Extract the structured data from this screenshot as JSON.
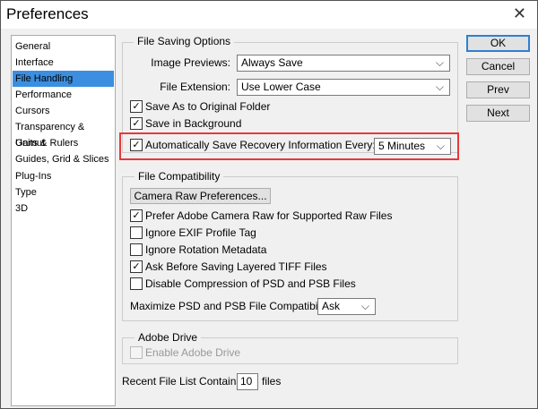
{
  "title": "Preferences",
  "sidebar": {
    "items": [
      "General",
      "Interface",
      "File Handling",
      "Performance",
      "Cursors",
      "Transparency & Gamut",
      "Units & Rulers",
      "Guides, Grid & Slices",
      "Plug-Ins",
      "Type",
      "3D"
    ],
    "selected": "File Handling"
  },
  "buttons": {
    "ok": "OK",
    "cancel": "Cancel",
    "prev": "Prev",
    "next": "Next"
  },
  "file_saving": {
    "legend": "File Saving Options",
    "image_previews_label": "Image Previews:",
    "image_previews_value": "Always Save",
    "file_extension_label": "File Extension:",
    "file_extension_value": "Use Lower Case",
    "save_original": "Save As to Original Folder",
    "save_background": "Save in Background",
    "auto_save": "Automatically Save Recovery Information Every:",
    "auto_save_value": "5 Minutes"
  },
  "compat": {
    "legend": "File Compatibility",
    "camera_raw_button": "Camera Raw Preferences...",
    "items": [
      {
        "label": "Prefer Adobe Camera Raw for Supported Raw Files",
        "checked": true
      },
      {
        "label": "Ignore EXIF Profile Tag",
        "checked": false
      },
      {
        "label": "Ignore Rotation Metadata",
        "checked": false
      },
      {
        "label": "Ask Before Saving Layered TIFF Files",
        "checked": true
      },
      {
        "label": "Disable Compression of PSD and PSB Files",
        "checked": false
      }
    ],
    "maximize_label": "Maximize PSD and PSB File Compatibility:",
    "maximize_value": "Ask"
  },
  "drive": {
    "legend": "Adobe Drive",
    "enable": "Enable Adobe Drive"
  },
  "recent": {
    "label": "Recent File List Contains:",
    "value": "10",
    "suffix": "files"
  },
  "check": "✓",
  "highlight_color": "#e8383c"
}
